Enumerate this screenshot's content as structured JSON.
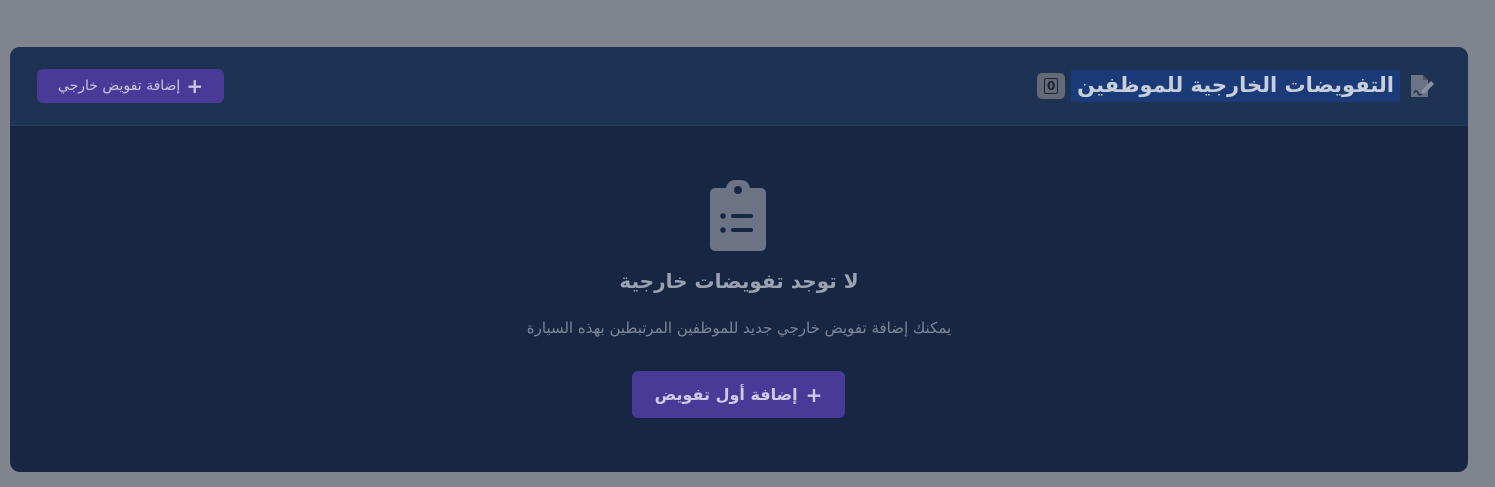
{
  "header": {
    "title": "التفويضات الخارجية للموظفين",
    "count": "0",
    "title_icon": "file-signature-icon",
    "add_button_label": "إضافة تفويض خارجي",
    "add_button_icon": "plus-icon"
  },
  "empty_state": {
    "icon": "clipboard-list-icon",
    "title": "لا توجد تفويضات خارجية",
    "description": "يمكنك إضافة تفويض خارجي جديد للموظفين المرتبطين بهذه السيارة",
    "button_label": "إضافة أول تفويض",
    "button_icon": "plus-icon"
  },
  "colors": {
    "overlay": "#80848f",
    "card_bg": "#172743",
    "header_bg": "#1e3254",
    "accent": "#4a3a97",
    "title_highlight": "#1b3a78"
  }
}
